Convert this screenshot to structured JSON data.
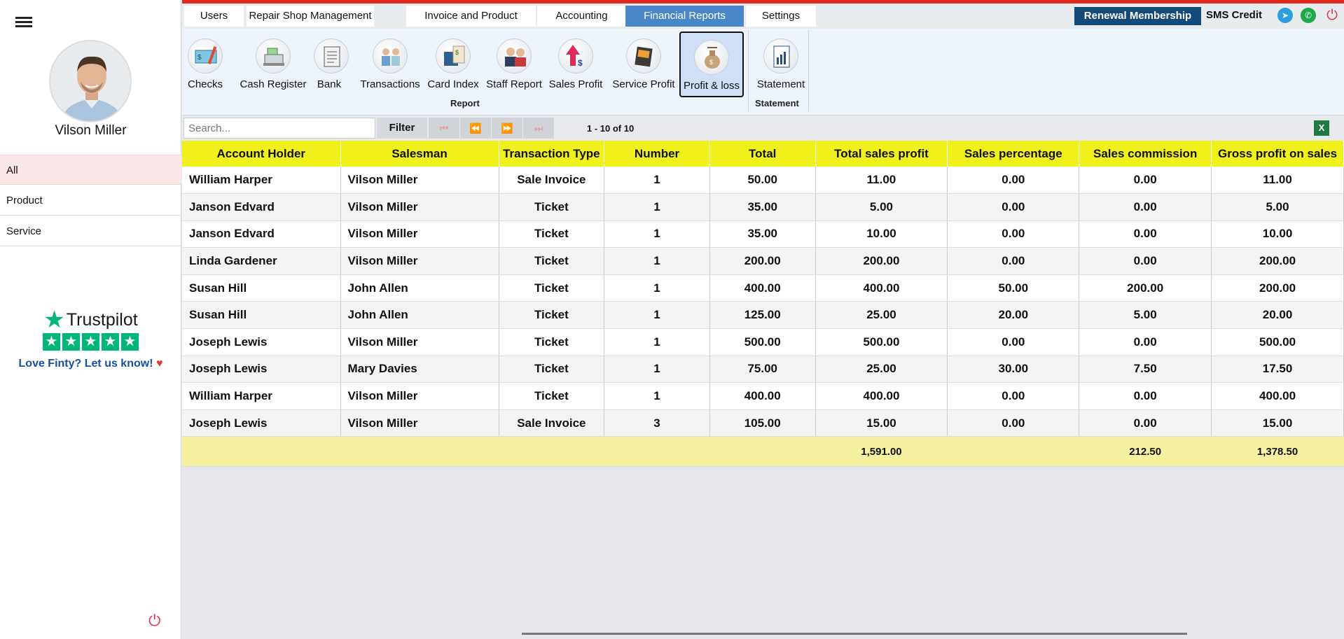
{
  "user": {
    "name": "Vilson Miller"
  },
  "sidebar": {
    "items": [
      {
        "label": "All"
      },
      {
        "label": "Product"
      },
      {
        "label": "Service"
      }
    ]
  },
  "trustpilot": {
    "brand": "Trustpilot",
    "prompt": "Love Finty? Let us know!"
  },
  "tabs": [
    {
      "label": "Users"
    },
    {
      "label": "Repair Shop Management"
    },
    {
      "label": "Invoice and Product"
    },
    {
      "label": "Accounting"
    },
    {
      "label": "Financial Reports"
    },
    {
      "label": "Settings"
    }
  ],
  "active_tab": "Financial Reports",
  "header": {
    "renewal_label": "Renewal Membership",
    "sms_label": "SMS Credit"
  },
  "ribbon": {
    "buttons": [
      {
        "label": "Checks",
        "icon": "checks-icon"
      },
      {
        "label": "Cash Register",
        "icon": "cash-register-icon"
      },
      {
        "label": "Bank",
        "icon": "bank-icon"
      },
      {
        "label": "Transactions",
        "icon": "transactions-icon"
      },
      {
        "label": "Card Index",
        "icon": "card-index-icon"
      },
      {
        "label": "Staff Report",
        "icon": "staff-report-icon"
      },
      {
        "label": "Sales Profit",
        "icon": "sales-profit-icon"
      },
      {
        "label": "Service Profit",
        "icon": "service-profit-icon"
      },
      {
        "label": "Profit & loss",
        "icon": "profit-loss-icon"
      },
      {
        "label": "Statement",
        "icon": "statement-icon"
      }
    ],
    "groups": [
      {
        "label": "Report"
      },
      {
        "label": "Statement"
      }
    ],
    "active": "Profit & loss"
  },
  "toolbar": {
    "search_placeholder": "Search...",
    "filter_label": "Filter",
    "range_text": "1 - 10 of 10"
  },
  "table": {
    "columns": [
      "Account Holder",
      "Salesman",
      "Transaction Type",
      "Number",
      "Total",
      "Total sales profit",
      "Sales percentage",
      "Sales commission",
      "Gross profit on sales"
    ],
    "rows": [
      [
        "William Harper",
        "Vilson Miller",
        "Sale Invoice",
        "1",
        "50.00",
        "11.00",
        "0.00",
        "0.00",
        "11.00"
      ],
      [
        "Janson Edvard",
        "Vilson Miller",
        "Ticket",
        "1",
        "35.00",
        "5.00",
        "0.00",
        "0.00",
        "5.00"
      ],
      [
        "Janson Edvard",
        "Vilson Miller",
        "Ticket",
        "1",
        "35.00",
        "10.00",
        "0.00",
        "0.00",
        "10.00"
      ],
      [
        "Linda Gardener",
        "Vilson Miller",
        "Ticket",
        "1",
        "200.00",
        "200.00",
        "0.00",
        "0.00",
        "200.00"
      ],
      [
        "Susan Hill",
        "John Allen",
        "Ticket",
        "1",
        "400.00",
        "400.00",
        "50.00",
        "200.00",
        "200.00"
      ],
      [
        "Susan Hill",
        "John Allen",
        "Ticket",
        "1",
        "125.00",
        "25.00",
        "20.00",
        "5.00",
        "20.00"
      ],
      [
        "Joseph Lewis",
        "Vilson Miller",
        "Ticket",
        "1",
        "500.00",
        "500.00",
        "0.00",
        "0.00",
        "500.00"
      ],
      [
        "Joseph Lewis",
        "Mary Davies",
        "Ticket",
        "1",
        "75.00",
        "25.00",
        "30.00",
        "7.50",
        "17.50"
      ],
      [
        "William Harper",
        "Vilson Miller",
        "Ticket",
        "1",
        "400.00",
        "400.00",
        "0.00",
        "0.00",
        "400.00"
      ],
      [
        "Joseph Lewis",
        "Vilson Miller",
        "Sale Invoice",
        "3",
        "105.00",
        "15.00",
        "0.00",
        "0.00",
        "15.00"
      ]
    ],
    "totals": [
      "",
      "",
      "",
      "",
      "",
      "1,591.00",
      "",
      "212.50",
      "1,378.50"
    ]
  }
}
